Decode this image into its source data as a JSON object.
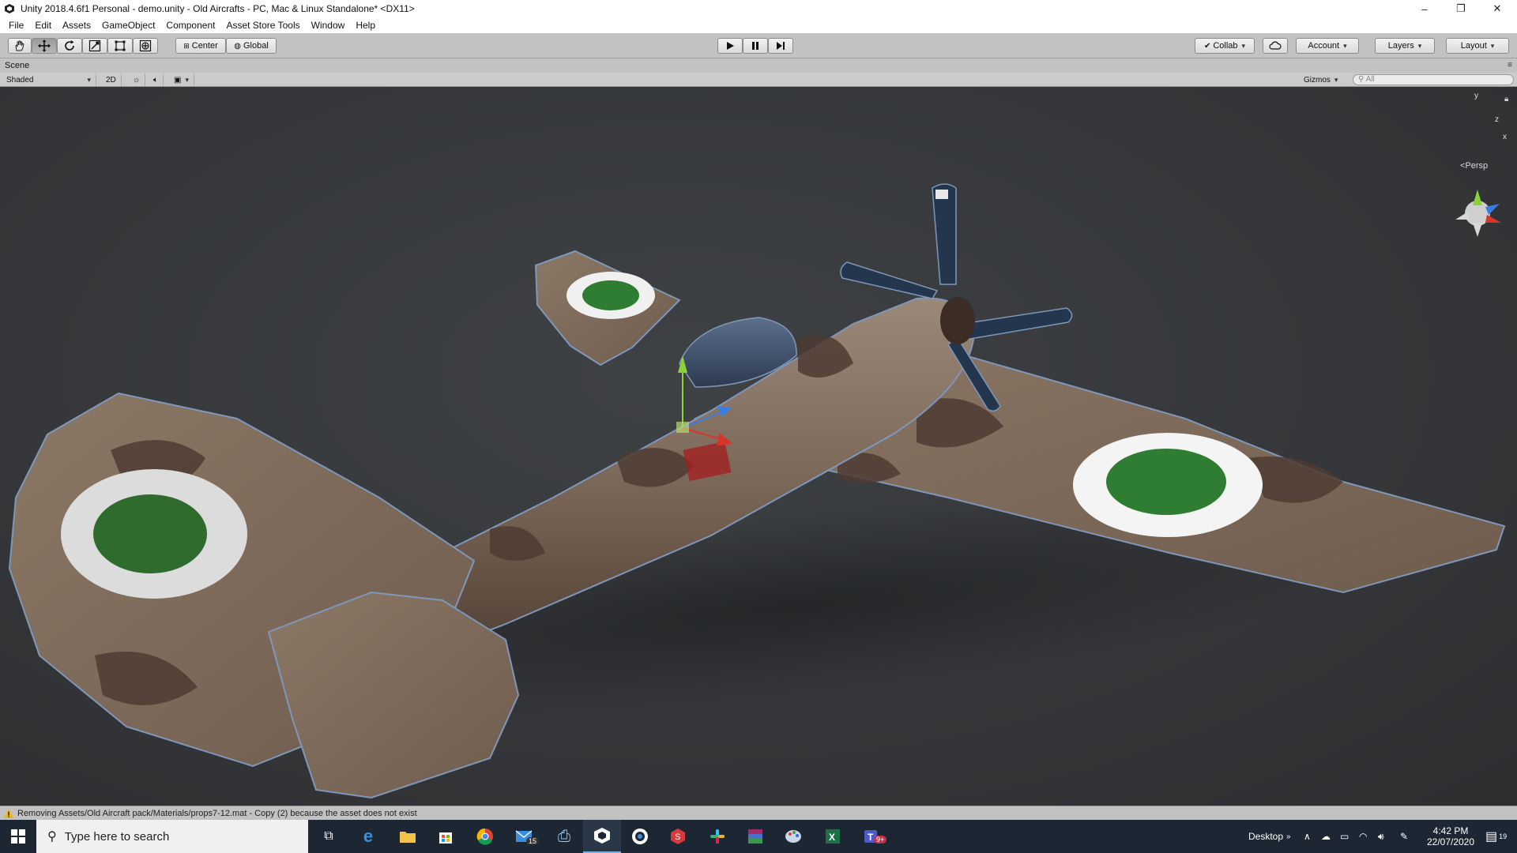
{
  "window": {
    "title": "Unity 2018.4.6f1 Personal - demo.unity - Old Aircrafts - PC, Mac & Linux Standalone* <DX11>",
    "controls": {
      "minimize": "–",
      "restore": "❐",
      "close": "✕"
    }
  },
  "menu": [
    "File",
    "Edit",
    "Assets",
    "GameObject",
    "Component",
    "Asset Store Tools",
    "Window",
    "Help"
  ],
  "toolbar": {
    "pivot_label": "Center",
    "space_label": "Global",
    "collab_label": "Collab",
    "account_label": "Account",
    "layers_label": "Layers",
    "layout_label": "Layout"
  },
  "scene": {
    "tab_label": "Scene",
    "shading_mode": "Shaded",
    "mode_2d": "2D",
    "gizmos_label": "Gizmos",
    "search_placeholder": "All",
    "persp_label": "Persp",
    "axis_labels": {
      "y": "y",
      "z": "z",
      "x": "x"
    }
  },
  "status": {
    "message": "Removing Assets/Old Aircraft pack/Materials/props7-12.mat - Copy (2) because the asset does not exist"
  },
  "taskbar": {
    "search_placeholder": "Type here to search",
    "desktop_label": "Desktop",
    "time": "4:42 PM",
    "date": "22/07/2020",
    "mail_badge": "15",
    "teams_badge": "9+",
    "notification_count": "19",
    "apps": [
      "task-view",
      "edge",
      "file-explorer",
      "store",
      "chrome",
      "mail",
      "printer",
      "unity",
      "app-circle",
      "app-s",
      "slack",
      "winrar",
      "paint",
      "excel",
      "teams"
    ]
  },
  "colors": {
    "editor_bg": "#c2c2c2",
    "viewport_bg": "#35373a",
    "roundel_outer": "#f2f2f2",
    "roundel_inner": "#2e7d32",
    "camo_light": "#8a7463",
    "camo_dark": "#4e3b33",
    "taskbar_bg": "#1c2733"
  }
}
